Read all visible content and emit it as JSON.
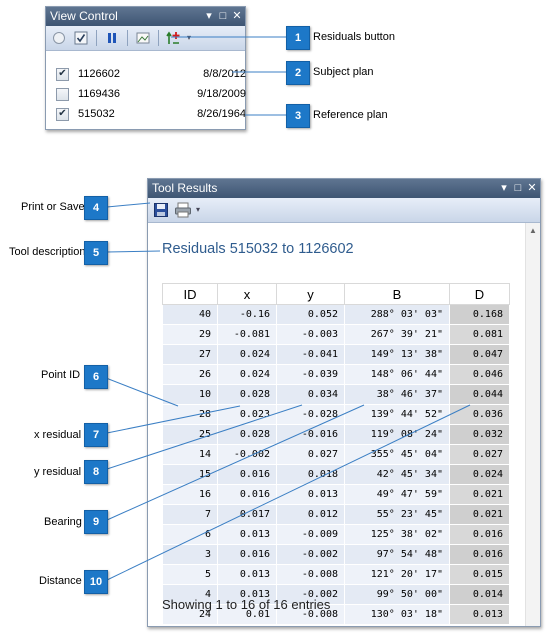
{
  "view_control": {
    "title": "View Control",
    "title_buttons": [
      "▾",
      "□",
      "✕"
    ],
    "toolbar_icons": [
      "radio-icon",
      "checkbox-icon",
      "pause-icon",
      "image-icon",
      "residuals-icon",
      "overflow-icon"
    ],
    "plans": [
      {
        "id": "1126602",
        "date": "8/8/2012",
        "checked": true
      },
      {
        "id": "1169436",
        "date": "9/18/2009",
        "checked": false
      },
      {
        "id": "515032",
        "date": "8/26/1964",
        "checked": true
      }
    ]
  },
  "callouts": [
    {
      "num": "1",
      "label": "Residuals button"
    },
    {
      "num": "2",
      "label": "Subject plan"
    },
    {
      "num": "3",
      "label": "Reference plan"
    },
    {
      "num": "4",
      "label": "Print or Save"
    },
    {
      "num": "5",
      "label": "Tool description"
    },
    {
      "num": "6",
      "label": "Point ID"
    },
    {
      "num": "7",
      "label": "x residual"
    },
    {
      "num": "8",
      "label": "y residual"
    },
    {
      "num": "9",
      "label": "Bearing"
    },
    {
      "num": "10",
      "label": "Distance"
    }
  ],
  "tool_results": {
    "title": "Tool Results",
    "title_buttons": [
      "▾",
      "□",
      "✕"
    ],
    "toolbar_icons": [
      "save-icon",
      "print-icon",
      "overflow-icon"
    ],
    "description": "Residuals 515032 to 1126602",
    "columns": [
      "ID",
      "x",
      "y",
      "B",
      "D"
    ],
    "rows": [
      [
        "40",
        "-0.16",
        "0.052",
        "288° 03' 03\"",
        "0.168"
      ],
      [
        "29",
        "-0.081",
        "-0.003",
        "267° 39' 21\"",
        "0.081"
      ],
      [
        "27",
        "0.024",
        "-0.041",
        "149° 13' 38\"",
        "0.047"
      ],
      [
        "26",
        "0.024",
        "-0.039",
        "148° 06' 44\"",
        "0.046"
      ],
      [
        "10",
        "0.028",
        "0.034",
        "38° 46' 37\"",
        "0.044"
      ],
      [
        "28",
        "0.023",
        "-0.028",
        "139° 44' 52\"",
        "0.036"
      ],
      [
        "25",
        "0.028",
        "-0.016",
        "119° 08' 24\"",
        "0.032"
      ],
      [
        "14",
        "-0.002",
        "0.027",
        "355° 45' 04\"",
        "0.027"
      ],
      [
        "15",
        "0.016",
        "0.018",
        "42° 45' 34\"",
        "0.024"
      ],
      [
        "16",
        "0.016",
        "0.013",
        "49° 47' 59\"",
        "0.021"
      ],
      [
        "7",
        "0.017",
        "0.012",
        "55° 23' 45\"",
        "0.021"
      ],
      [
        "6",
        "0.013",
        "-0.009",
        "125° 38' 02\"",
        "0.016"
      ],
      [
        "3",
        "0.016",
        "-0.002",
        "97° 54' 48\"",
        "0.016"
      ],
      [
        "5",
        "0.013",
        "-0.008",
        "121° 20' 17\"",
        "0.015"
      ],
      [
        "4",
        "0.013",
        "-0.002",
        "99° 50' 00\"",
        "0.014"
      ],
      [
        "24",
        "0.01",
        "-0.008",
        "130° 03' 18\"",
        "0.013"
      ]
    ],
    "footer": "Showing 1 to 16 of 16 entries"
  }
}
